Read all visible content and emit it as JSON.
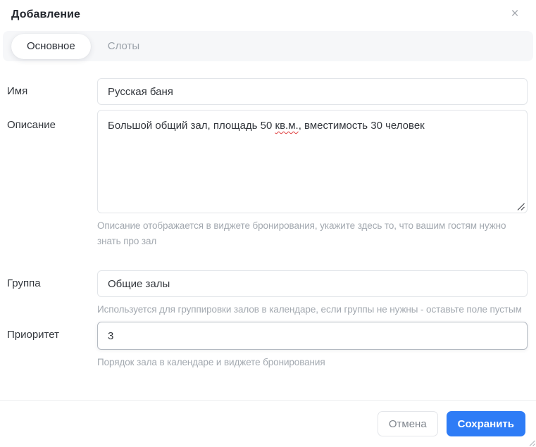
{
  "dialog": {
    "title": "Добавление",
    "close_icon": "×"
  },
  "tabs": [
    {
      "label": "Основное",
      "active": true
    },
    {
      "label": "Слоты",
      "active": false
    }
  ],
  "form": {
    "name": {
      "label": "Имя",
      "value": "Русская баня"
    },
    "description": {
      "label": "Описание",
      "value_before": "Большой общий зал, площадь 50 ",
      "value_misspelled": "кв.м.",
      "value_after": ", вместимость 30 человек",
      "value_full": "Большой общий зал, площадь 50 кв.м., вместимость 30 человек",
      "hint": "Описание отображается в виджете бронирования, укажите здесь то, что вашим гостям нужно знать про зал"
    },
    "group": {
      "label": "Группа",
      "value": "Общие залы",
      "hint": "Используется для группировки залов в календаре, если группы не нужны - оставьте поле пустым"
    },
    "priority": {
      "label": "Приоритет",
      "value": "3",
      "hint": "Порядок зала в календаре и виджете бронирования"
    }
  },
  "footer": {
    "cancel_label": "Отмена",
    "save_label": "Сохранить"
  },
  "colors": {
    "accent": "#2e7cf6",
    "spellcheck_underline": "#de3c3c",
    "tab_strip_bg": "#f6f7f9",
    "hint_text": "#a3a9b0"
  }
}
